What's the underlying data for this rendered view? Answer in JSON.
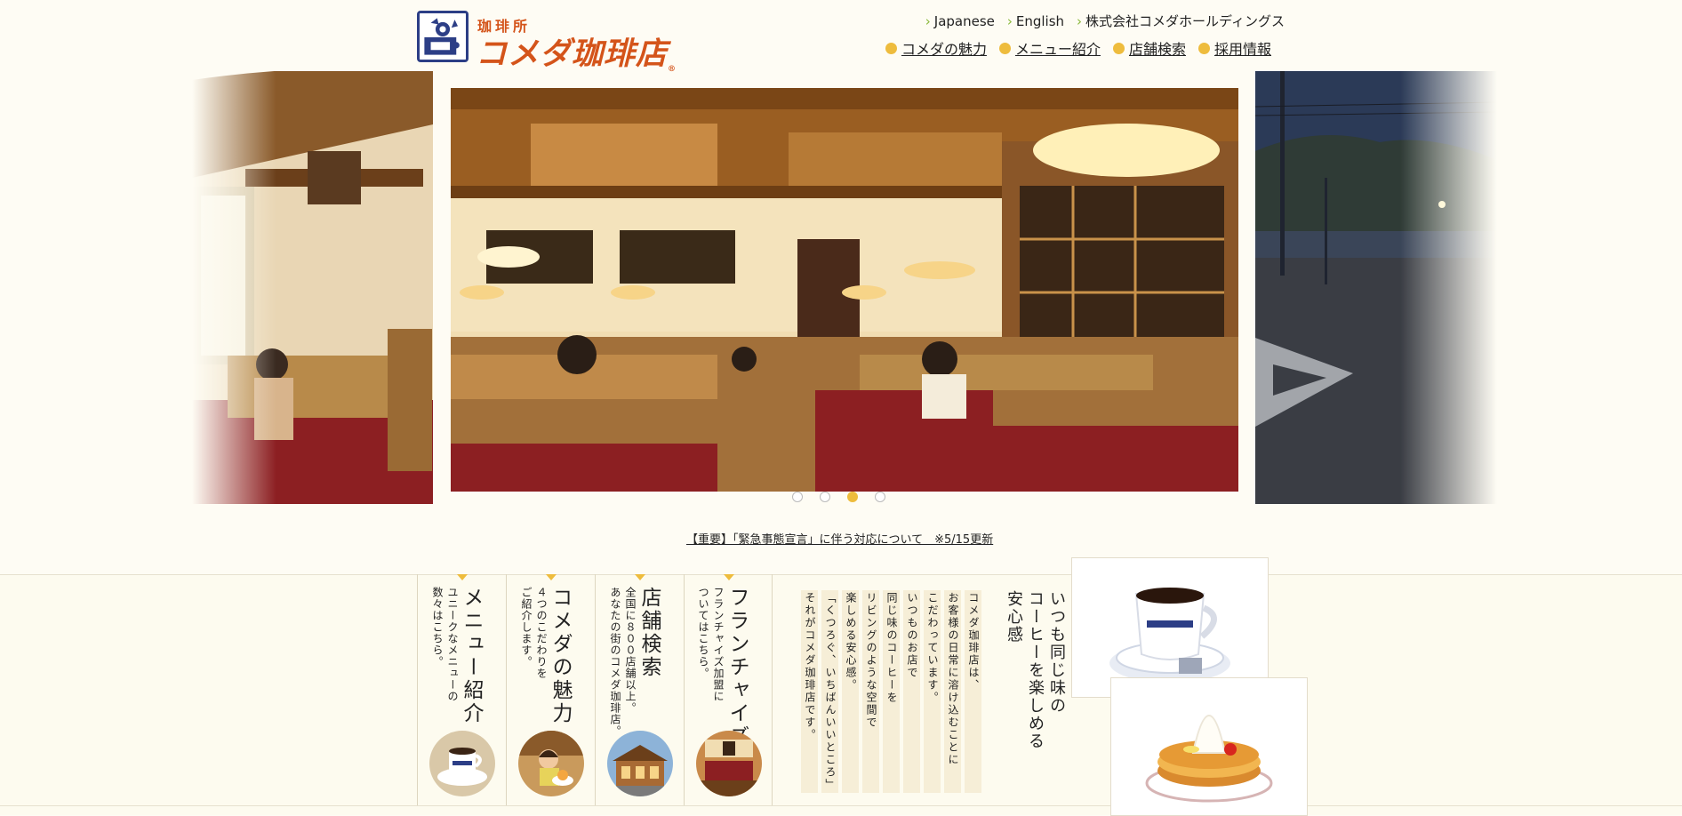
{
  "logo": {
    "small": "珈琲所",
    "main": "コメダ珈琲店",
    "reg": "®"
  },
  "top_links": [
    {
      "label": "Japanese"
    },
    {
      "label": "English"
    },
    {
      "label": "株式会社コメダホールディングス"
    }
  ],
  "main_nav": [
    {
      "label": "コメダの魅力"
    },
    {
      "label": "メニュー紹介"
    },
    {
      "label": "店舗検索"
    },
    {
      "label": "採用情報"
    }
  ],
  "carousel": {
    "slide_count": 4,
    "active_index": 2
  },
  "notice": "【重要】「緊急事態宣言」に伴う対応について　※5/15更新",
  "cards": [
    {
      "title": "メニュー紹介",
      "desc": "ユニークなメニューの\n数々はこちら。",
      "icon": "coffee-cup-icon"
    },
    {
      "title": "コメダの魅力",
      "desc": "４つのこだわりを\nご紹介します。",
      "icon": "child-with-dessert-icon"
    },
    {
      "title": "店舗検索",
      "desc": "全国に８００店舗以上。\nあなたの街のコメダ珈琲店。",
      "icon": "storefront-icon"
    },
    {
      "title": "フランチャイズ",
      "desc": "フランチャイズ加盟に\nついてはこちら。",
      "icon": "booth-seat-icon"
    }
  ],
  "story": {
    "heading": "いつも同じ味の\nコーヒーを楽しめる\n安心感",
    "lines": [
      "コメダ珈琲店は、",
      "お客様の日常に溶け込むことに",
      "こだわっています。",
      "いつものお店で",
      "同じ味のコーヒーを",
      "リビングのような空間で",
      "楽しめる安心感。",
      "「くつろぐ、いちばんいいところ」",
      "それがコメダ珈琲店です。"
    ]
  },
  "colors": {
    "accent": "#eebc3d",
    "brand": "#d4541a",
    "background": "#fefcf4"
  }
}
